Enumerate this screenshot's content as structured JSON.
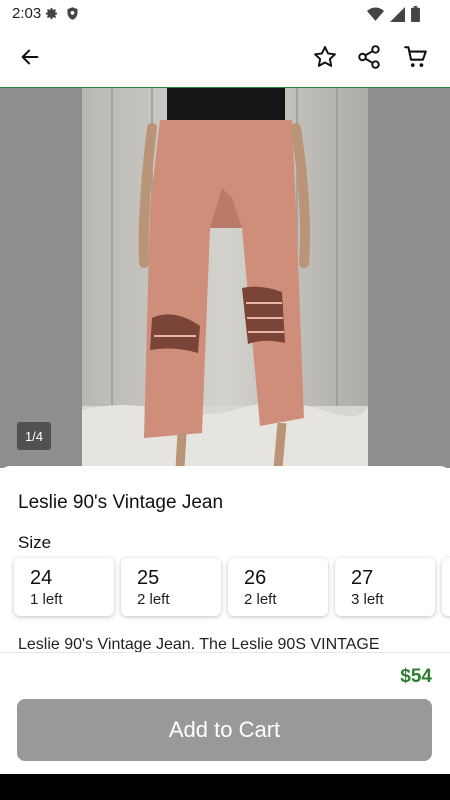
{
  "status_bar": {
    "time": "2:03",
    "left_icons": [
      "gear-icon",
      "shield-icon"
    ],
    "right_icons": [
      "wifi-icon",
      "signal-icon",
      "battery-icon"
    ]
  },
  "app_bar": {
    "back_icon": "arrow-left-icon",
    "actions": [
      "star-outline-icon",
      "share-icon",
      "cart-icon"
    ],
    "accent": "#2e7d32"
  },
  "gallery": {
    "counter": "1/4"
  },
  "product": {
    "title": "Leslie 90's Vintage Jean",
    "size_label": "Size",
    "sizes": [
      {
        "size": "24",
        "stock": "1 left"
      },
      {
        "size": "25",
        "stock": "2 left"
      },
      {
        "size": "26",
        "stock": "2 left"
      },
      {
        "size": "27",
        "stock": "3 left"
      }
    ],
    "description": "Leslie 90's Vintage Jean. The Leslie 90S VINTAGE"
  },
  "purchase": {
    "price": "$54",
    "add_to_cart": "Add to Cart",
    "price_color": "#2e7d32",
    "button_color": "#999999"
  }
}
